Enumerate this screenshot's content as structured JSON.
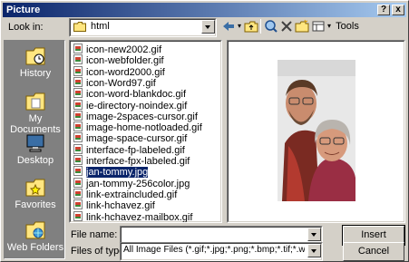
{
  "window": {
    "title": "Picture"
  },
  "title_buttons": {
    "help": "?",
    "close": "x"
  },
  "look_in": {
    "label": "Look in:",
    "value": "html"
  },
  "toolbar": {
    "tools_label": "Tools"
  },
  "places": [
    {
      "label": "History",
      "icon": "history-icon"
    },
    {
      "label": "My Documents",
      "icon": "my-documents-icon"
    },
    {
      "label": "Desktop",
      "icon": "desktop-icon"
    },
    {
      "label": "Favorites",
      "icon": "favorites-icon"
    },
    {
      "label": "Web Folders",
      "icon": "web-folders-icon"
    }
  ],
  "files": [
    "icon-new2002.gif",
    "icon-webfolder.gif",
    "icon-word2000.gif",
    "icon-Word97.gif",
    "icon-word-blankdoc.gif",
    "ie-directory-noindex.gif",
    "image-2spaces-cursor.gif",
    "image-home-notloaded.gif",
    "image-space-cursor.gif",
    "interface-fp-labeled.gif",
    "interface-fpx-labeled.gif",
    "jan-tommy.jpg",
    "jan-tommy-256color.jpg",
    "link-extraincluded.gif",
    "link-hchavez.gif",
    "link-hchavez-mailbox.gif"
  ],
  "selected_file": "jan-tommy.jpg",
  "file_name": {
    "label": "File name:",
    "value": ""
  },
  "files_of_type": {
    "label": "Files of type:",
    "value": "All Image Files (*.gif;*.jpg;*.png;*.bmp;*.tif;*.wmf;*.ras"
  },
  "buttons": {
    "insert": "Insert",
    "cancel": "Cancel"
  },
  "colors": {
    "titlebar_start": "#0a246a",
    "titlebar_end": "#a6caf0",
    "face": "#d4d0c8",
    "places_bg": "#808080",
    "selection": "#0a246a"
  }
}
